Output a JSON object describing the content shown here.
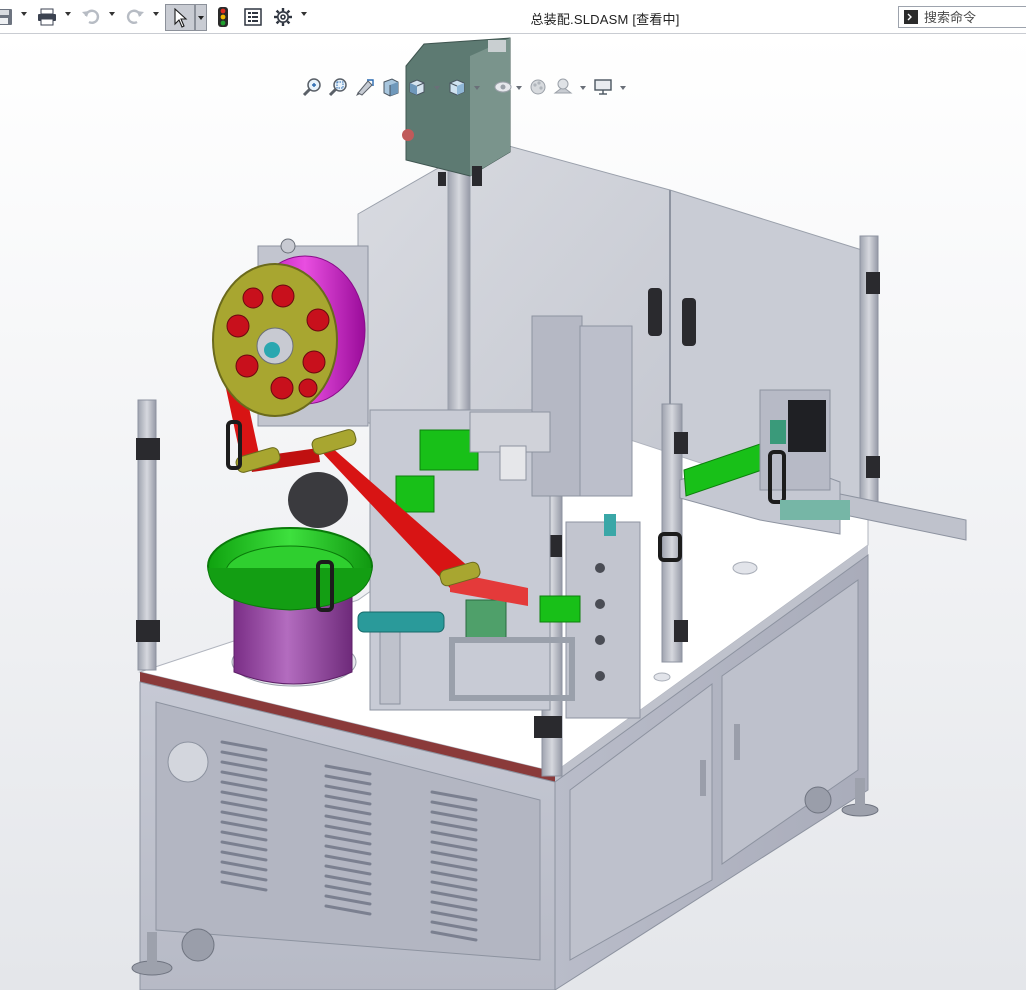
{
  "window": {
    "title": "总装配.SLDASM [查看中]"
  },
  "toolbar": {
    "items": [
      "save-icon",
      "print-icon",
      "undo-icon",
      "redo-icon",
      "select-arrow-icon",
      "traffic-light-icon",
      "file-properties-icon",
      "options-gear-icon"
    ]
  },
  "search": {
    "placeholder": "搜索命令"
  },
  "heads_up_view": {
    "items": [
      "zoom-to-fit-icon",
      "zoom-to-area-icon",
      "previous-view-icon",
      "section-view-icon",
      "view-orientation-icon",
      "display-style-icon",
      "hide-show-items-icon",
      "edit-appearance-icon",
      "apply-scene-icon",
      "view-settings-icon"
    ]
  },
  "colors": {
    "frame": "#b9bcc8",
    "cabinet": "#c3c6d2",
    "tabletop": "#ffffff",
    "belt_red": "#d81414",
    "green": "#18c018",
    "magenta": "#d020c8",
    "olive": "#a8a630",
    "teal": "#2a9a9a",
    "purple": "#9a4aa8"
  }
}
